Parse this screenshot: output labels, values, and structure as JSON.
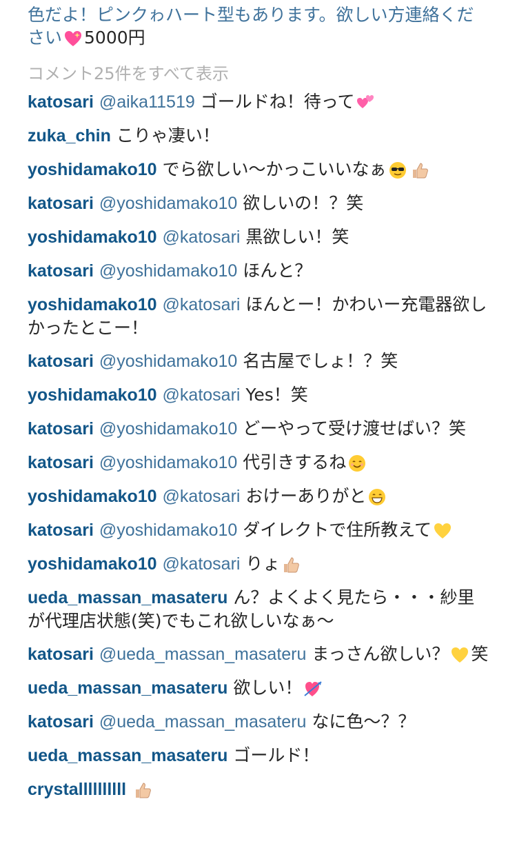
{
  "caption": {
    "text_part1": "色だよ！ピンクゎハート型もあります。欲しい方連絡ください",
    "text_part2": "5000円"
  },
  "view_all_comments": "コメント25件をすべて表示",
  "comments": [
    {
      "user": "katosari",
      "mention": "@aika11519",
      "text": "ゴールドね！待って",
      "emoji": "two-hearts-icon"
    },
    {
      "user": "zuka_chin",
      "mention": "",
      "text": "こりゃ凄い！"
    },
    {
      "user": "yoshidamako10",
      "mention": "",
      "text": "でら欲しい〜かっこいいなぁ",
      "emoji": "sunglasses-thumbsup-icon"
    },
    {
      "user": "katosari",
      "mention": "@yoshidamako10",
      "text": "欲しいの！？笑"
    },
    {
      "user": "yoshidamako10",
      "mention": "@katosari",
      "text": "黒欲しい！笑"
    },
    {
      "user": "katosari",
      "mention": "@yoshidamako10",
      "text": "ほんと？"
    },
    {
      "user": "yoshidamako10",
      "mention": "@katosari",
      "text": "ほんとー！かわいー充電器欲しかったとこー！"
    },
    {
      "user": "katosari",
      "mention": "@yoshidamako10",
      "text": "名古屋でしょ！？笑"
    },
    {
      "user": "yoshidamako10",
      "mention": "@katosari",
      "text": "Yes！笑"
    },
    {
      "user": "katosari",
      "mention": "@yoshidamako10",
      "text": "どーやって受け渡せばい？笑"
    },
    {
      "user": "katosari",
      "mention": "@yoshidamako10",
      "text": "代引きするね",
      "emoji": "smile-icon"
    },
    {
      "user": "yoshidamako10",
      "mention": "@katosari",
      "text": "おけーありがと",
      "emoji": "grin-icon"
    },
    {
      "user": "katosari",
      "mention": "@yoshidamako10",
      "text": "ダイレクトで住所教えて",
      "emoji": "yellow-heart-icon"
    },
    {
      "user": "yoshidamako10",
      "mention": "@katosari",
      "text": "りょ",
      "emoji": "thumbs-up-icon"
    },
    {
      "user": "ueda_massan_masateru",
      "mention": "",
      "text": "ん？よくよく見たら・・・紗里が代理店状態(笑)でもこれ欲しいなぁ〜"
    },
    {
      "user": "katosari",
      "mention": "@ueda_massan_masateru",
      "text": "まっさん欲しい？",
      "emoji_mid": "yellow-heart-icon",
      "text_after": "笑"
    },
    {
      "user": "ueda_massan_masateru",
      "mention": "",
      "text": "欲しい！",
      "emoji": "heart-arrow-icon"
    },
    {
      "user": "katosari",
      "mention": "@ueda_massan_masateru",
      "text": "なに色〜？？"
    },
    {
      "user": "ueda_massan_masateru",
      "mention": "",
      "text": "ゴールド！"
    },
    {
      "user": "crystallllllllll",
      "mention": "",
      "text": "",
      "emoji": "thumbs-up-icon"
    }
  ],
  "colors": {
    "username": "#125688",
    "mention": "#3f729b",
    "muted": "#b0b0b0",
    "text": "#262626"
  }
}
